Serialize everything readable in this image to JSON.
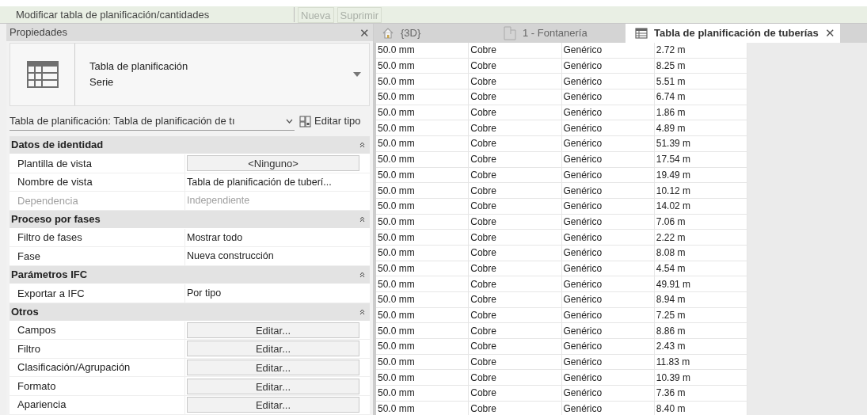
{
  "ribbon": {
    "title": "Modificar tabla de planificación/cantidades",
    "buttons": [
      {
        "label": "Nueva",
        "disabled": true
      },
      {
        "label": "Suprimir",
        "disabled": true
      }
    ]
  },
  "properties": {
    "title": "Propiedades",
    "close": "✕",
    "type_selector": {
      "line1": "Tabla de planificación",
      "line2": "Serie"
    },
    "instance_dropdown": "Tabla de planificación: Tabla de planificación de tı",
    "edit_type": "Editar tipo",
    "sections": [
      {
        "title": "Datos de identidad",
        "expanded": true,
        "rows": [
          {
            "label": "Plantilla de vista",
            "value": "<Ninguno>",
            "kind": "button",
            "disabled": false
          },
          {
            "label": "Nombre de vista",
            "value": "Tabla de planificación de tuberí...",
            "kind": "text",
            "disabled": false
          },
          {
            "label": "Dependencia",
            "value": "Independiente",
            "kind": "text",
            "disabled": true
          }
        ]
      },
      {
        "title": "Proceso por fases",
        "expanded": true,
        "rows": [
          {
            "label": "Filtro de fases",
            "value": "Mostrar todo",
            "kind": "text",
            "disabled": false
          },
          {
            "label": "Fase",
            "value": "Nueva construcción",
            "kind": "text",
            "disabled": false
          }
        ]
      },
      {
        "title": "Parámetros IFC",
        "expanded": true,
        "rows": [
          {
            "label": "Exportar a IFC",
            "value": "Por tipo",
            "kind": "text",
            "disabled": false
          }
        ]
      },
      {
        "title": "Otros",
        "expanded": true,
        "rows": [
          {
            "label": "Campos",
            "value": "Editar...",
            "kind": "button",
            "disabled": false
          },
          {
            "label": "Filtro",
            "value": "Editar...",
            "kind": "button",
            "disabled": false
          },
          {
            "label": "Clasificación/Agrupación",
            "value": "Editar...",
            "kind": "button",
            "disabled": false
          },
          {
            "label": "Formato",
            "value": "Editar...",
            "kind": "button",
            "disabled": false
          },
          {
            "label": "Apariencia",
            "value": "Editar...",
            "kind": "button",
            "disabled": false
          }
        ]
      }
    ]
  },
  "view_tabs": [
    {
      "label": "{3D}",
      "kind": "model",
      "selected": false
    },
    {
      "label": "1 - Fontanería",
      "kind": "plan",
      "selected": false
    },
    {
      "label": "Tabla de planificación de tuberías",
      "kind": "schedule",
      "selected": true,
      "close": "✕"
    }
  ],
  "table": {
    "rows": [
      [
        "50.0 mm",
        "Cobre",
        "Genérico",
        "2.72 m"
      ],
      [
        "50.0 mm",
        "Cobre",
        "Genérico",
        "8.25 m"
      ],
      [
        "50.0 mm",
        "Cobre",
        "Genérico",
        "5.51 m"
      ],
      [
        "50.0 mm",
        "Cobre",
        "Genérico",
        "6.74 m"
      ],
      [
        "50.0 mm",
        "Cobre",
        "Genérico",
        "1.86 m"
      ],
      [
        "50.0 mm",
        "Cobre",
        "Genérico",
        "4.89 m"
      ],
      [
        "50.0 mm",
        "Cobre",
        "Genérico",
        "51.39 m"
      ],
      [
        "50.0 mm",
        "Cobre",
        "Genérico",
        "17.54 m"
      ],
      [
        "50.0 mm",
        "Cobre",
        "Genérico",
        "19.49 m"
      ],
      [
        "50.0 mm",
        "Cobre",
        "Genérico",
        "10.12 m"
      ],
      [
        "50.0 mm",
        "Cobre",
        "Genérico",
        "14.02 m"
      ],
      [
        "50.0 mm",
        "Cobre",
        "Genérico",
        "7.06 m"
      ],
      [
        "50.0 mm",
        "Cobre",
        "Genérico",
        "2.22 m"
      ],
      [
        "50.0 mm",
        "Cobre",
        "Genérico",
        "8.08 m"
      ],
      [
        "50.0 mm",
        "Cobre",
        "Genérico",
        "4.54 m"
      ],
      [
        "50.0 mm",
        "Cobre",
        "Genérico",
        "49.91 m"
      ],
      [
        "50.0 mm",
        "Cobre",
        "Genérico",
        "8.94 m"
      ],
      [
        "50.0 mm",
        "Cobre",
        "Genérico",
        "7.25 m"
      ],
      [
        "50.0 mm",
        "Cobre",
        "Genérico",
        "8.86 m"
      ],
      [
        "50.0 mm",
        "Cobre",
        "Genérico",
        "2.43 m"
      ],
      [
        "50.0 mm",
        "Cobre",
        "Genérico",
        "11.83 m"
      ],
      [
        "50.0 mm",
        "Cobre",
        "Genérico",
        "10.39 m"
      ],
      [
        "50.0 mm",
        "Cobre",
        "Genérico",
        "7.36 m"
      ],
      [
        "50.0 mm",
        "Cobre",
        "Genérico",
        "8.40 m"
      ]
    ]
  }
}
